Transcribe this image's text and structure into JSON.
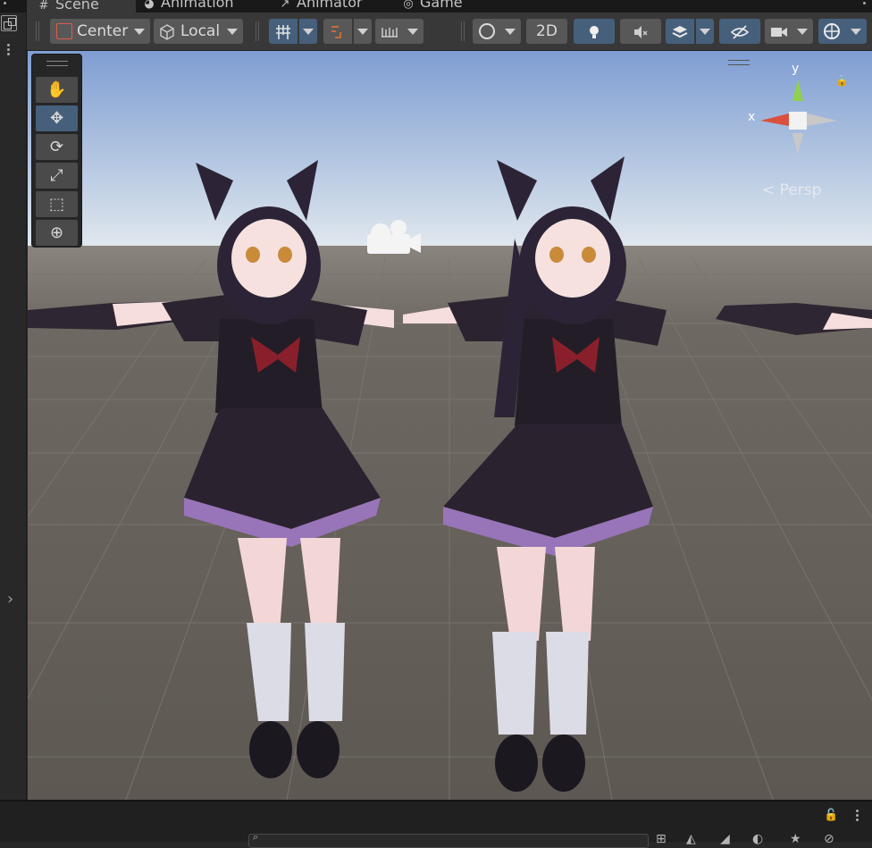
{
  "tabs": [
    {
      "label": "Scene",
      "icon": "grid-hash-icon"
    },
    {
      "label": "Animation",
      "icon": "animation-clock-icon"
    },
    {
      "label": "Animator",
      "icon": "animator-graph-icon"
    },
    {
      "label": "Game",
      "icon": "gamepad-icon"
    }
  ],
  "toolbar": {
    "pivot_mode": "Center",
    "pivot_rotation": "Local",
    "mode_2d": "2D"
  },
  "gizmo": {
    "axis_x": "x",
    "axis_y": "y",
    "projection": "< Persp"
  },
  "colors": {
    "active_blue": "#46607c",
    "axis_x": "#d9503e",
    "axis_y": "#8fd14c",
    "panel": "#383838"
  }
}
